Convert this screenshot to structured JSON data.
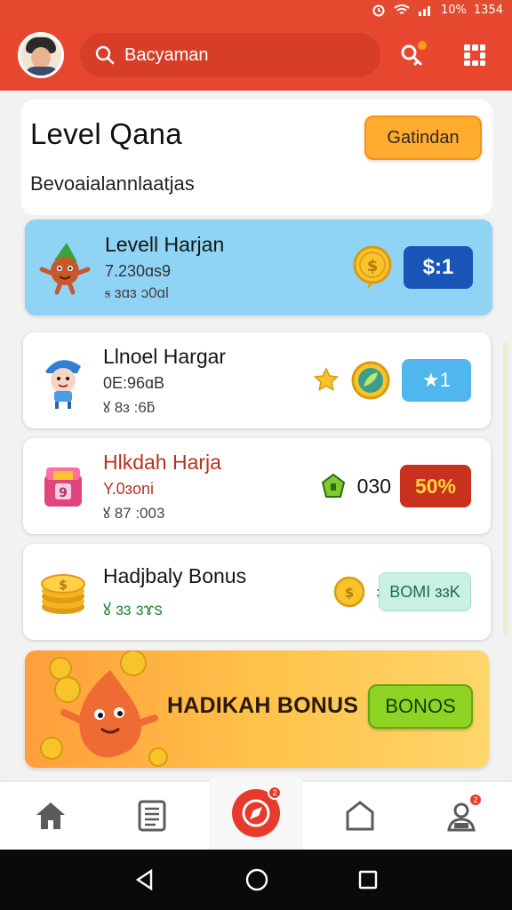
{
  "status_bar": {
    "battery": "10%",
    "time": "1354"
  },
  "header": {
    "search_placeholder": "Bacyaman"
  },
  "title_card": {
    "title": "Level Qana",
    "subtitle": "Bevoaialannlaatjas",
    "button_label": "Gatindan"
  },
  "rows": [
    {
      "title": "Levell Harjan",
      "sub": "7.230ɑs9",
      "meta": "ꭶ ɜɑɜ ɔ0ɑl",
      "pill": "$:1"
    },
    {
      "title": "Llnoel Hargar",
      "sub": "0E:96ɑB",
      "meta": "ꙋ 8ɜ :6ƃ",
      "pill": "★1"
    },
    {
      "title": "Hlkdah Harja",
      "sub": "Y.0ɜoni",
      "meta": "ꙋ 87 :003",
      "mid_text": "030",
      "pill": "50%"
    },
    {
      "title": "Hadjbaly Bonus",
      "meta": "ꙋ ɜɜ ɜɤs",
      "mid_text": "ɜɜ",
      "pill": "BOMI ɜɜK"
    }
  ],
  "banner": {
    "title": "HADIKAH BONUS",
    "button_label": "BONOS"
  },
  "bottom_nav": {
    "center_badge": "2",
    "profile_badge": "2"
  },
  "colors": {
    "accent_red": "#e8472f",
    "orange_button": "#ffac2f",
    "green_button": "#8fd425"
  },
  "icons": [
    "search-icon",
    "key-icon",
    "grid-icon",
    "home-icon",
    "list-icon",
    "compass-icon",
    "bookmark-icon",
    "profile-icon",
    "coin-icon",
    "star-icon",
    "leaf-badge-icon",
    "gem-icon"
  ]
}
